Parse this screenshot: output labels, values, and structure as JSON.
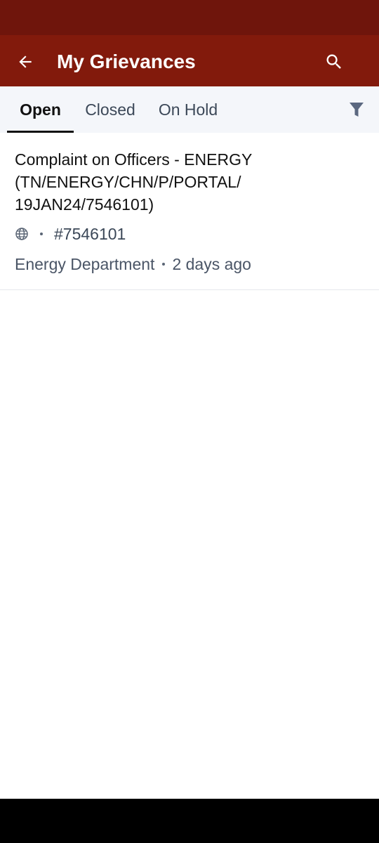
{
  "header": {
    "title": "My Grievances",
    "back_icon": "arrow-left-icon",
    "search_icon": "search-icon",
    "bar_color": "#821a0c",
    "status_bar_color": "#6f150c"
  },
  "tabs": [
    {
      "label": "Open",
      "active": true
    },
    {
      "label": "Closed",
      "active": false
    },
    {
      "label": "On Hold",
      "active": false
    }
  ],
  "filter_icon": "filter-icon",
  "grievances": [
    {
      "title_lines": [
        "Complaint on Officers - ENERGY",
        "(TN/ENERGY/CHN/P/PORTAL/",
        "19JAN24/7546101)"
      ],
      "source_icon": "globe-icon",
      "id": "#7546101",
      "department": "Energy Department",
      "time": "2 days ago"
    }
  ]
}
